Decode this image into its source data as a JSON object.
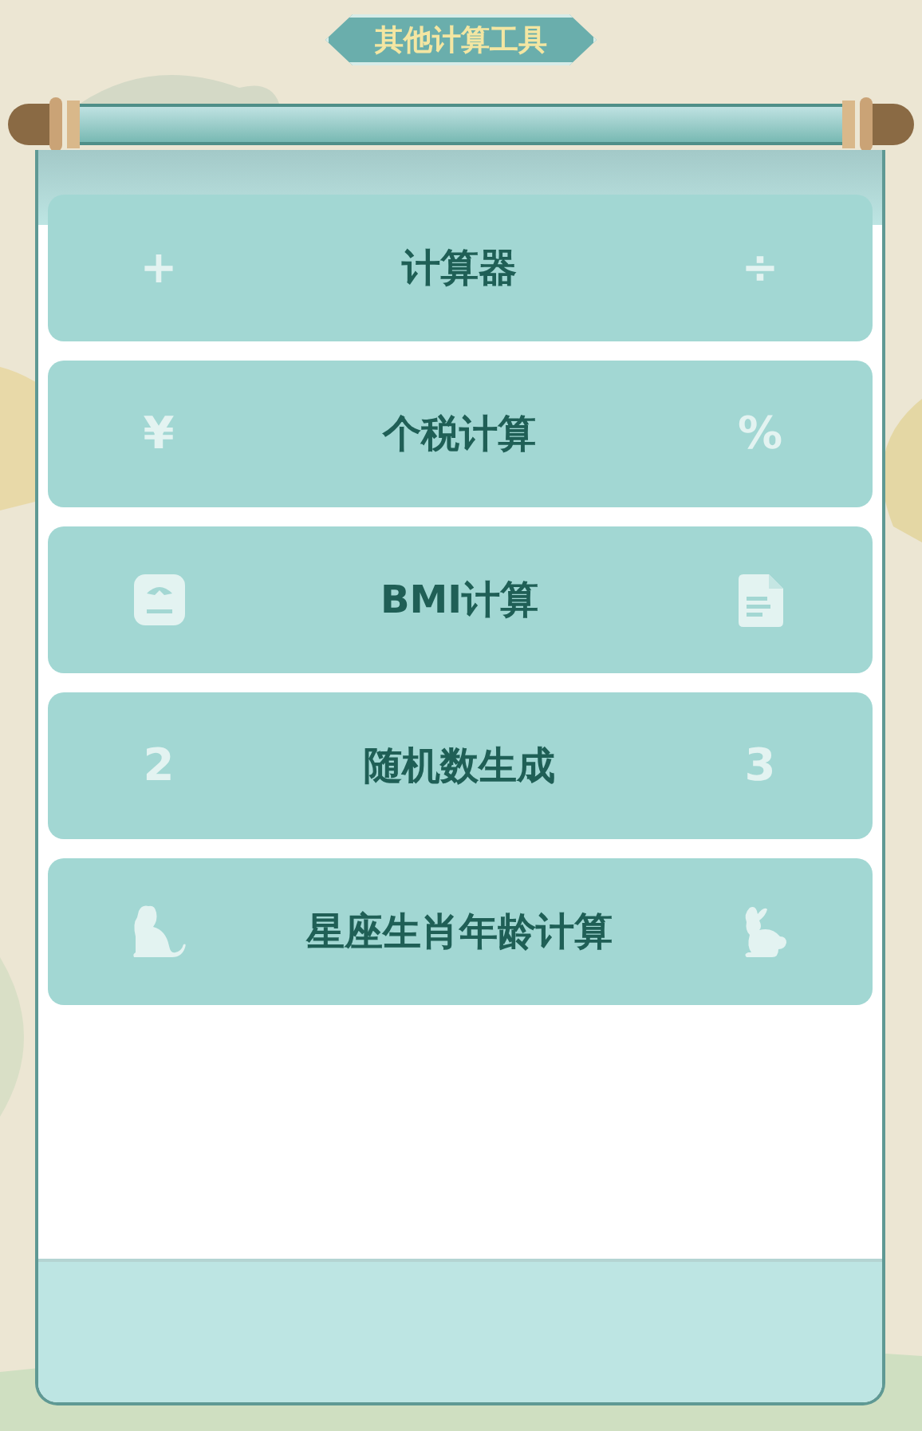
{
  "title": "其他计算工具",
  "tools": [
    {
      "label": "计算器",
      "left": {
        "kind": "glyph",
        "text": "+"
      },
      "right": {
        "kind": "glyph",
        "text": "÷"
      }
    },
    {
      "label": "个税计算",
      "left": {
        "kind": "glyph",
        "text": "¥"
      },
      "right": {
        "kind": "glyph",
        "text": "%"
      }
    },
    {
      "label": "BMI计算",
      "left": {
        "kind": "icon"
      },
      "right": {
        "kind": "icon"
      }
    },
    {
      "label": "随机数生成",
      "left": {
        "kind": "glyph",
        "text": "2"
      },
      "right": {
        "kind": "glyph",
        "text": "3"
      }
    },
    {
      "label": "星座生肖年龄计算",
      "left": {
        "kind": "icon"
      },
      "right": {
        "kind": "icon"
      }
    }
  ]
}
